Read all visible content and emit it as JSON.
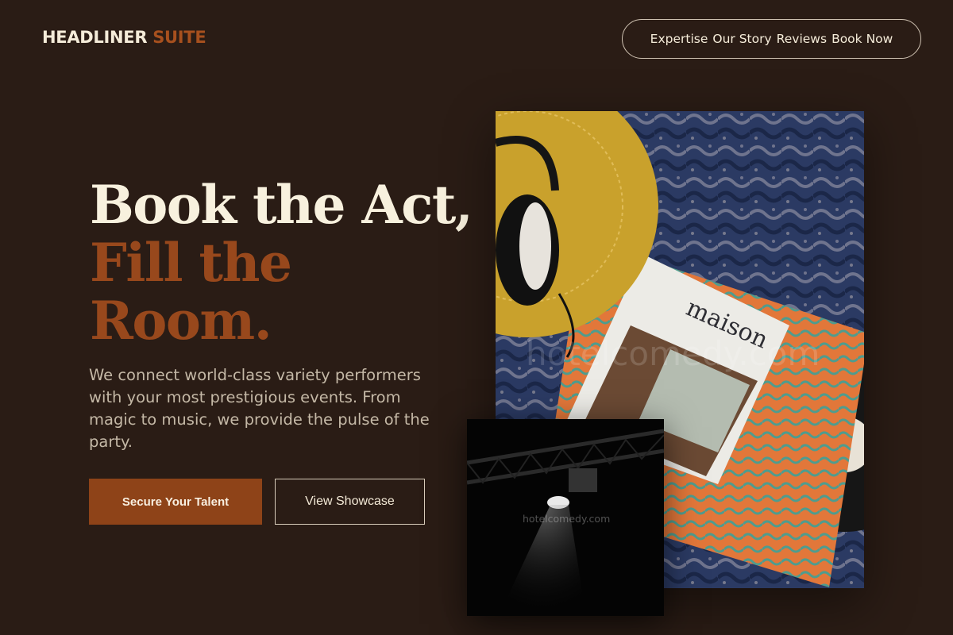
{
  "brand": {
    "name_primary": "HEADLINER",
    "name_accent": "SUITE"
  },
  "nav": {
    "items": [
      "Expertise",
      "Our Story",
      "Reviews",
      "Book Now"
    ]
  },
  "hero": {
    "headline_line1": "Book the Act,",
    "headline_line2": "Fill the",
    "headline_line3": "Room.",
    "description": "We connect world-class variety performers with your most prestigious events. From magic to music, we provide the pulse of the party.",
    "primary_cta": "Secure Your Talent",
    "secondary_cta": "View Showcase"
  },
  "images": {
    "main_watermark": "hotelcomedy.com",
    "magazine_title": "maison",
    "spotlight_watermark": "hotelcomedy.com"
  },
  "colors": {
    "background": "#2a1c15",
    "accent": "#8e4318",
    "headline_light": "#f8f1de",
    "headline_accent": "#98481c"
  }
}
